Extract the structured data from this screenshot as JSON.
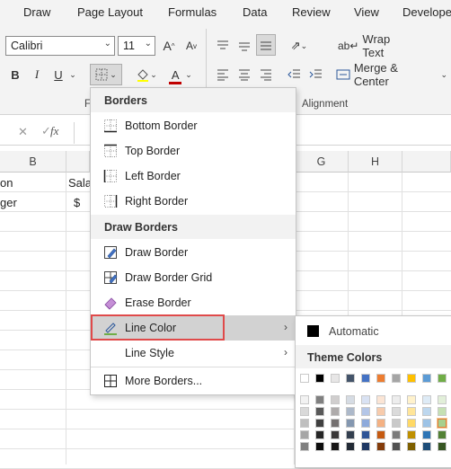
{
  "ribbon": {
    "tabs": [
      "Draw",
      "Page Layout",
      "Formulas",
      "Data",
      "Review",
      "View",
      "Develope"
    ],
    "font_name": "Calibri",
    "font_size": "11",
    "bold_label": "B",
    "italic_label": "I",
    "underline_label": "U",
    "wrap_text_label": "Wrap Text",
    "merge_center_label": "Merge & Center",
    "group_font_label": "F",
    "group_alignment_label": "Alignment",
    "increase_font_label": "A",
    "decrease_font_label": "A",
    "font_color_label": "A",
    "font_color": "#c00000"
  },
  "formula_bar": {
    "fx_label": "fx"
  },
  "columns": [
    "B",
    "G",
    "H"
  ],
  "cells": {
    "b1": "on",
    "b2": "ger",
    "c1": "Sala",
    "c2": "$"
  },
  "borders_menu": {
    "header_borders": "Borders",
    "bottom_border": "Bottom Border",
    "top_border": "Top Border",
    "left_border": "Left Border",
    "right_border": "Right Border",
    "header_draw": "Draw Borders",
    "draw_border": "Draw Border",
    "draw_border_grid": "Draw Border Grid",
    "erase_border": "Erase Border",
    "line_color": "Line Color",
    "line_style": "Line Style",
    "more_borders": "More Borders..."
  },
  "line_color_submenu": {
    "automatic": "Automatic",
    "theme_colors": "Theme Colors",
    "top_row_colors": [
      "#ffffff",
      "#000000",
      "#e7e6e6",
      "#44546a",
      "#4472c4",
      "#ed7d31",
      "#a5a5a5",
      "#ffc000",
      "#5b9bd5",
      "#70ad47"
    ],
    "shade_columns": [
      [
        "#f2f2f2",
        "#d9d9d9",
        "#bfbfbf",
        "#a6a6a6",
        "#808080"
      ],
      [
        "#808080",
        "#595959",
        "#404040",
        "#262626",
        "#0d0d0d"
      ],
      [
        "#d0cece",
        "#aeabab",
        "#757171",
        "#3a3838",
        "#171616"
      ],
      [
        "#d6dce4",
        "#adb9ca",
        "#8497b0",
        "#333f4f",
        "#222a35"
      ],
      [
        "#d9e2f3",
        "#b4c6e7",
        "#8eaadb",
        "#2f5496",
        "#1f3864"
      ],
      [
        "#fbe5d5",
        "#f7cbac",
        "#f4b183",
        "#c55a11",
        "#843c0b"
      ],
      [
        "#ededed",
        "#dbdbdb",
        "#c9c9c9",
        "#7b7b7b",
        "#525252"
      ],
      [
        "#fff2cc",
        "#ffe599",
        "#ffd966",
        "#bf9000",
        "#7f6000"
      ],
      [
        "#deebf6",
        "#bdd7ee",
        "#9dc3e6",
        "#2e75b5",
        "#1e4e79"
      ],
      [
        "#e2efd9",
        "#c5e0b3",
        "#a8d08d",
        "#538135",
        "#375623"
      ]
    ]
  }
}
